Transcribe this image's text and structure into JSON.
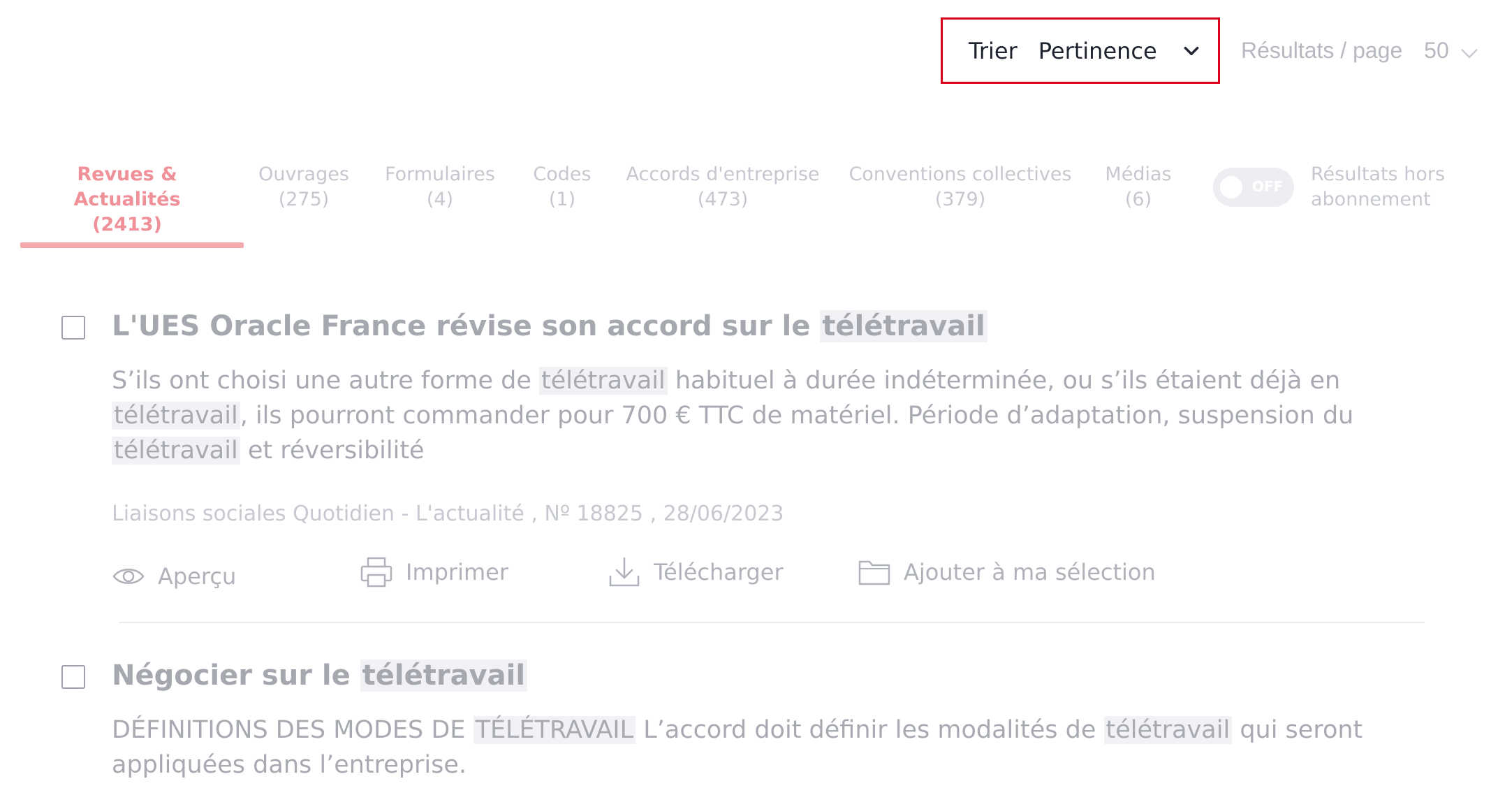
{
  "sort": {
    "label": "Trier",
    "value": "Pertinence"
  },
  "per_page": {
    "label": "Résultats / page",
    "value": "50"
  },
  "tabs": [
    {
      "label": "Revues & Actualités",
      "count": "(2413)"
    },
    {
      "label": "Ouvrages",
      "count": "(275)"
    },
    {
      "label": "Formulaires",
      "count": "(4)"
    },
    {
      "label": "Codes",
      "count": "(1)"
    },
    {
      "label": "Accords d'entreprise",
      "count": "(473)"
    },
    {
      "label": "Conventions collectives",
      "count": "(379)"
    },
    {
      "label": "Médias",
      "count": "(6)"
    }
  ],
  "toggle": {
    "state": "OFF",
    "label_line1": "Résultats hors",
    "label_line2": "abonnement"
  },
  "results": [
    {
      "title_before": "L'UES Oracle France révise son accord sur le ",
      "title_highlight": "télétravail",
      "desc": {
        "p1": "S’ils ont choisi une autre forme de ",
        "h1": "télétravail",
        "p2": " habituel à durée indéterminée, ou s’ils étaient déjà en ",
        "h2": "télétravail",
        "p3": ", ils pourront commander pour 700 € TTC de matériel. Période d’adaptation, suspension du ",
        "h3": "télétravail",
        "p4": " et réversibilité"
      },
      "meta": "Liaisons sociales Quotidien - L'actualité , Nº 18825 , 28/06/2023"
    },
    {
      "title_before": "Négocier sur le ",
      "title_highlight": "télétravail",
      "desc": {
        "p1": "DÉFINITIONS DES MODES DE ",
        "h1": "TÉLÉTRAVAIL",
        "p2": " L’accord doit définir les modalités de ",
        "h2": "télétravail",
        "p3": " qui seront appliquées dans l’entreprise."
      }
    }
  ],
  "actions": {
    "preview": "Aperçu",
    "print": "Imprimer",
    "download": "Télécharger",
    "add_selection": "Ajouter à ma sélection"
  },
  "icons": [
    "chevron-down-icon",
    "eye-icon",
    "printer-icon",
    "download-icon",
    "folder-icon"
  ],
  "colors": {
    "accent": "#f0919a",
    "sort_border": "#d8001a",
    "text_dark": "#1e2330"
  }
}
